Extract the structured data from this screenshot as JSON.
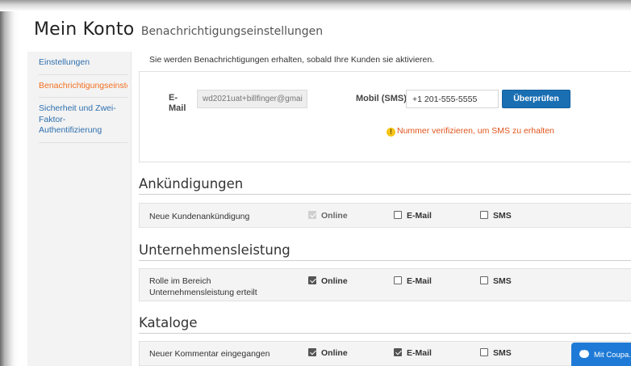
{
  "header": {
    "title": "Mein Konto",
    "subtitle": "Benachrichtigungseinstellungen"
  },
  "sidebar": {
    "items": [
      {
        "label": "Einstellungen"
      },
      {
        "label": "Benachrichtigungseinstellungen"
      },
      {
        "label": "Sicherheit und Zwei-Faktor-Authentifizierung"
      }
    ]
  },
  "notice": "Sie werden Benachrichtigungen erhalten, sobald Ihre Kunden sie aktivieren.",
  "contact": {
    "email_label": "E-Mail",
    "email_value": "wd2021uat+billfinger@gmai",
    "mobile_label": "Mobil (SMS)",
    "mobile_value": "+1 201-555-5555",
    "verify_button": "Überprüfen",
    "warning": "Nummer verifizieren, um SMS zu erhalten",
    "warning_color": "#e0541c"
  },
  "sections": [
    {
      "title": "Ankündigungen",
      "rows": [
        {
          "label": "Neue Kundenankündigung",
          "online": "Online",
          "email": "E-Mail",
          "sms": "SMS"
        }
      ]
    },
    {
      "title": "Unternehmensleistung",
      "rows": [
        {
          "label": "Rolle im Bereich Unternehmensleistung erteilt",
          "online": "Online",
          "email": "E-Mail",
          "sms": "SMS"
        }
      ]
    },
    {
      "title": "Kataloge",
      "rows": [
        {
          "label": "Neuer Kommentar eingegangen",
          "online": "Online",
          "email": "E-Mail",
          "sms": "SMS"
        }
      ]
    }
  ],
  "chat": {
    "label": "Mit Coupa..."
  },
  "colors": {
    "link": "#2f6fae",
    "active": "#f36f21",
    "primary_button": "#1a6fb3",
    "chat_button": "#1e7ad6"
  }
}
